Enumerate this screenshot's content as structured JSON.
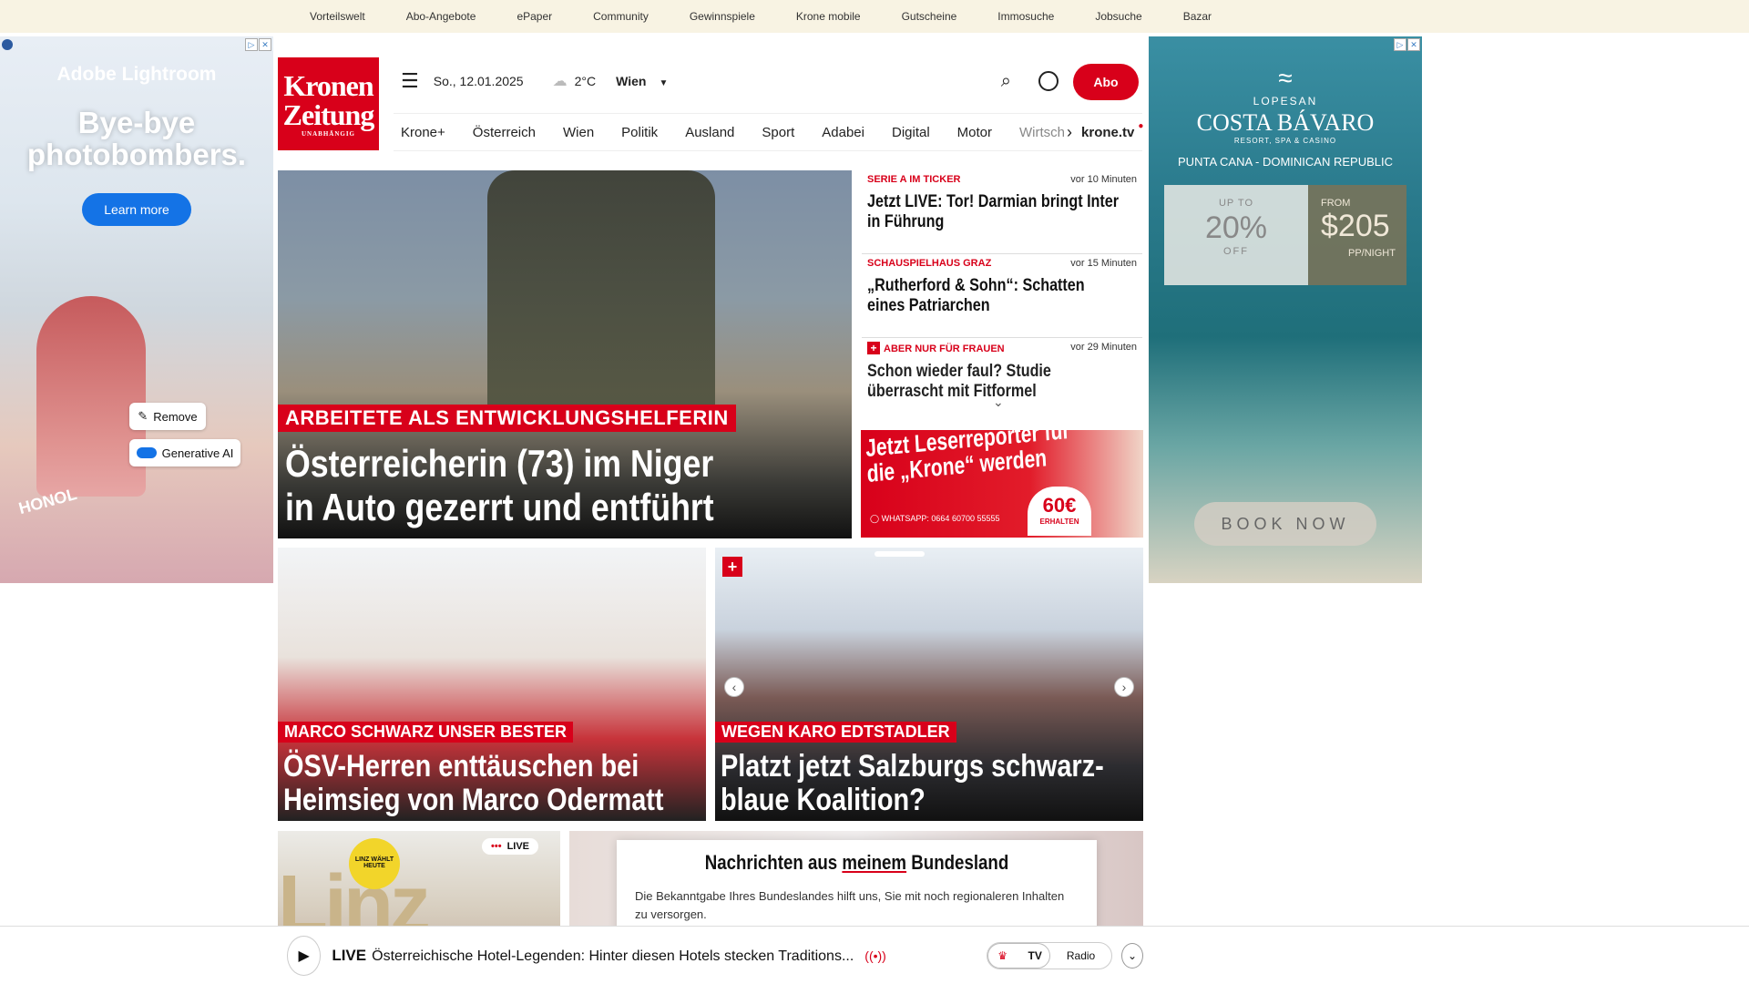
{
  "topbar": {
    "links": [
      "Vorteilswelt",
      "Abo-Angebote",
      "ePaper",
      "Community",
      "Gewinnspiele",
      "Krone mobile",
      "Gutscheine",
      "Immosuche",
      "Jobsuche",
      "Bazar"
    ]
  },
  "left_ad": {
    "brand": "Adobe Lightroom",
    "headline": "Bye-bye photobombers.",
    "cta": "Learn more",
    "chip1": "Remove",
    "chip2": "Generative AI",
    "cup_text": "HONOL"
  },
  "right_ad": {
    "brand": "LOPESAN",
    "name": "COSTA BÁVARO",
    "sub": "RESORT, SPA & CASINO",
    "place": "PUNTA CANA - DOMINICAN REPUBLIC",
    "upto": "UP TO",
    "pct": "20%",
    "off": "OFF",
    "from": "FROM",
    "price": "$205",
    "per": "PP/NIGHT",
    "cta": "BOOK NOW"
  },
  "logo": {
    "line1": "Kronen",
    "line2": "Zeitung",
    "line3": "UNABHÄNGIG"
  },
  "header": {
    "date": "So., 12.01.2025",
    "temp": "2°C",
    "city": "Wien",
    "abo": "Abo"
  },
  "nav": {
    "items": [
      "Krone+",
      "Österreich",
      "Wien",
      "Politik",
      "Ausland",
      "Sport",
      "Adabei",
      "Digital",
      "Motor",
      "Wirtsch"
    ],
    "tv": "krone.tv"
  },
  "hero": {
    "kicker": "ARBEITETE ALS ENTWICKLUNGSHELFERIN",
    "title": "Österreicherin (73) im Niger in Auto gezerrt und entführt"
  },
  "ticker": [
    {
      "cat": "SERIE A IM TICKER",
      "time": "vor 10 Minuten",
      "title": "Jetzt LIVE: Tor! Darmian bringt Inter in Führung"
    },
    {
      "cat": "SCHAUSPIELHAUS GRAZ",
      "time": "vor 15 Minuten",
      "title": "„Rutherford & Sohn“: Schatten eines Patriarchen"
    },
    {
      "cat": "ABER NUR FÜR FRAUEN",
      "time": "vor 29 Minuten",
      "title": "Schon wieder faul? Studie überrascht mit Fitformel"
    }
  ],
  "leserreporter": {
    "title": "Jetzt Leserreporter für die „Krone“ werden",
    "wa": "WHATSAPP: 0664 60700 55555",
    "amount": "60€",
    "amount_sub": "ERHALTEN"
  },
  "card1": {
    "kicker": "MARCO SCHWARZ UNSER BESTER",
    "title": "ÖSV-Herren enttäuschen bei Heimsieg von Marco Odermatt"
  },
  "card2": {
    "kicker": "WEGEN KARO EDTSTADLER",
    "title": "Platzt jetzt Salzburgs schwarz-blaue Koalition?"
  },
  "linz": {
    "live": "LIVE",
    "badge": "LINZ WÄHLT HEUTE"
  },
  "modal": {
    "title_a": "Nachrichten aus ",
    "title_b": "meinem",
    "title_c": " Bundesland",
    "text": "Die Bekanntgabe Ihres Bundeslandes hilft uns, Sie mit noch regionaleren Inhalten zu versorgen."
  },
  "player": {
    "live": "LIVE",
    "text": "Österreichische Hotel-Legenden: Hinter diesen Hotels stecken Traditions...",
    "tv": "TV",
    "radio": "Radio"
  },
  "colors": {
    "brand_red": "#d8001a",
    "topbar_bg": "#f8f3e3"
  }
}
